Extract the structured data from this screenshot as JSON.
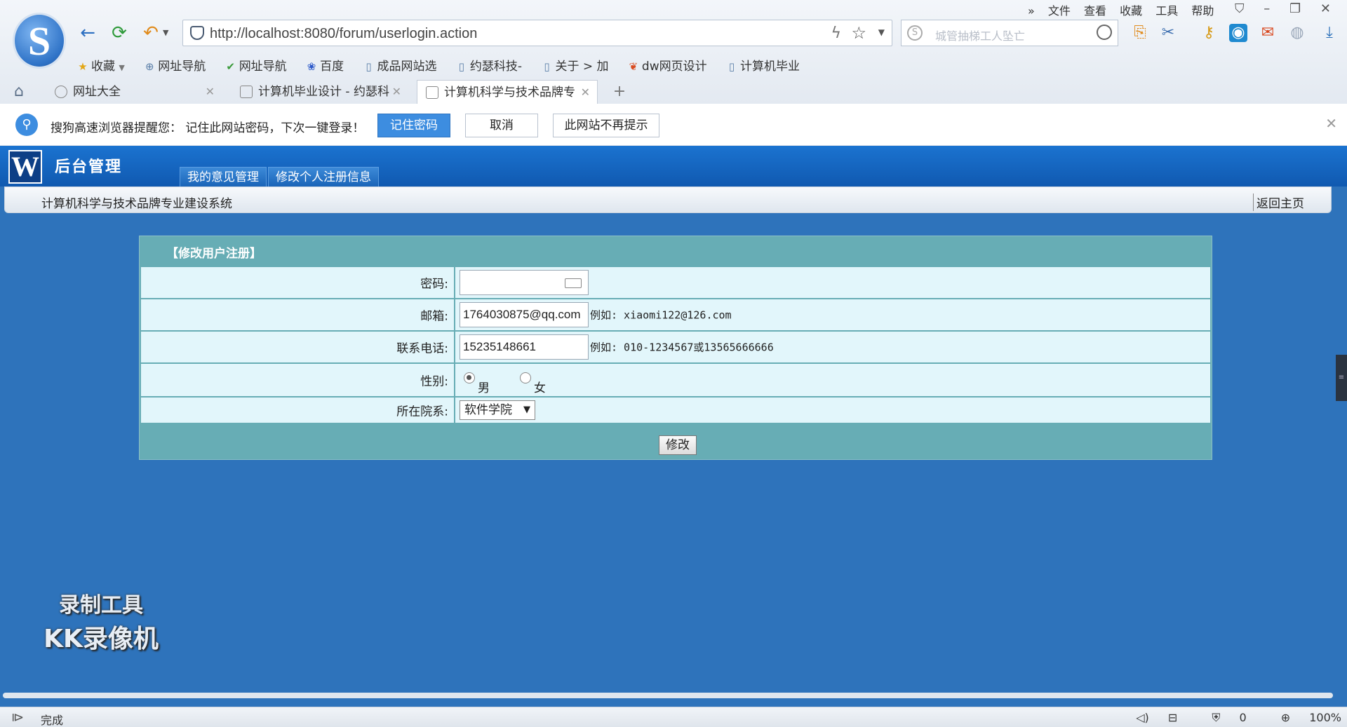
{
  "browser": {
    "url": "http://localhost:8080/forum/userlogin.action",
    "search_placeholder": "城管抽梯工人坠亡",
    "menu": [
      "文件",
      "查看",
      "收藏",
      "工具",
      "帮助"
    ],
    "menu_more": "»",
    "bookmarks": [
      "收藏",
      "网址导航",
      "网址导航",
      "百度",
      "成品网站选",
      "约瑟科技-",
      "关于 > 加",
      "dw网页设计",
      "计算机毕业"
    ],
    "tabs": [
      {
        "label": "网址大全",
        "active": false
      },
      {
        "label": "计算机毕业设计 - 约瑟科",
        "active": false
      },
      {
        "label": "计算机科学与技术品牌专",
        "active": true
      }
    ],
    "new_tab": "+"
  },
  "password_bar": {
    "message": "搜狗高速浏览器提醒您：  记住此网站密码，下次一键登录！",
    "remember": "记住密码",
    "cancel": "取消",
    "never": "此网站不再提示"
  },
  "header": {
    "logo_letter": "W",
    "title": "后台管理",
    "nav": [
      "我的意见管理",
      "修改个人注册信息"
    ]
  },
  "crumb": {
    "system_name": "计算机科学与技术品牌专业建设系统",
    "home_link": "返回主页"
  },
  "form": {
    "title": "【修改用户注册】",
    "password_label": "密码:",
    "password_value": "",
    "email_label": "邮箱:",
    "email_value": "1764030875@qq.com",
    "email_hint": "例如: xiaomi122@126.com",
    "phone_label": "联系电话:",
    "phone_value": "15235148661",
    "phone_hint": "例如: 010-1234567或13565666666",
    "gender_label": "性别:",
    "gender_male": "男",
    "gender_female": "女",
    "gender_selected": "男",
    "dept_label": "所在院系:",
    "dept_value": "软件学院",
    "submit": "修改"
  },
  "watermark": [
    "录制工具",
    "KK录像机"
  ],
  "status": {
    "text": "完成",
    "security_count": "0",
    "zoom": "100%"
  }
}
